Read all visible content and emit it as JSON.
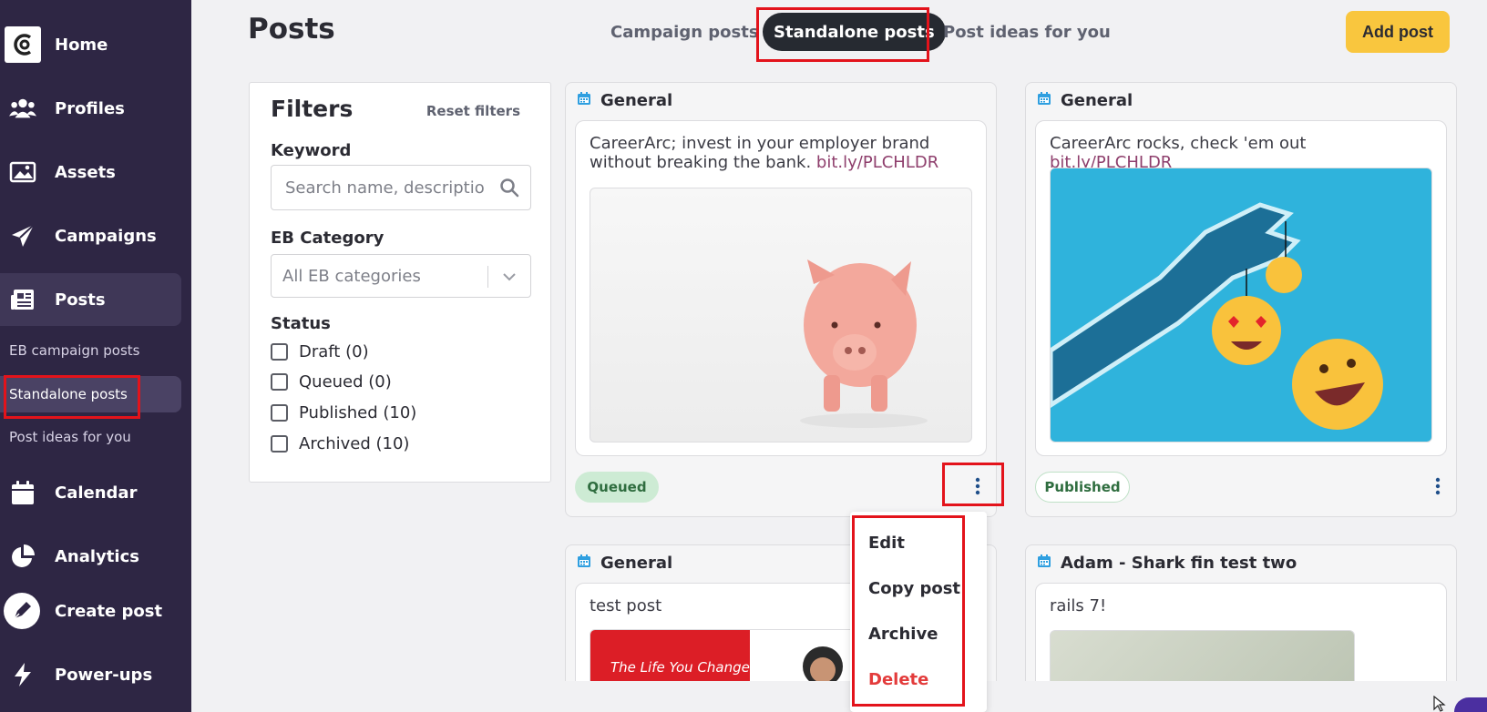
{
  "sidebar": {
    "items": [
      {
        "label": "Home",
        "icon": "home-logo-icon"
      },
      {
        "label": "Profiles",
        "icon": "users-icon"
      },
      {
        "label": "Assets",
        "icon": "image-icon"
      },
      {
        "label": "Campaigns",
        "icon": "paper-plane-icon"
      },
      {
        "label": "Posts",
        "icon": "newspaper-icon"
      },
      {
        "label": "Calendar",
        "icon": "calendar-icon"
      },
      {
        "label": "Analytics",
        "icon": "pie-chart-icon"
      },
      {
        "label": "Create post",
        "icon": "pen-icon"
      },
      {
        "label": "Power-ups",
        "icon": "bolt-icon"
      }
    ],
    "sub_items": [
      {
        "label": "EB campaign posts"
      },
      {
        "label": "Standalone posts"
      },
      {
        "label": "Post ideas for you"
      }
    ]
  },
  "header": {
    "title": "Posts",
    "tabs": [
      "Campaign posts",
      "Standalone posts",
      "Post ideas for you"
    ],
    "active_tab": "Standalone posts",
    "add_post_label": "Add post"
  },
  "filters": {
    "title": "Filters",
    "reset_label": "Reset filters",
    "keyword_label": "Keyword",
    "keyword_placeholder": "Search name, description",
    "category_label": "EB Category",
    "category_value": "All EB categories",
    "status_label": "Status",
    "statuses": [
      "Draft (0)",
      "Queued (0)",
      "Published (10)",
      "Archived (10)"
    ]
  },
  "cards": [
    {
      "category": "General",
      "text": "CareerArc; invest in your employer brand without breaking the bank.",
      "link": "bit.ly/PLCHLDR",
      "status": "Queued"
    },
    {
      "category": "General",
      "text": "CareerArc rocks, check 'em out",
      "link": "bit.ly/PLCHLDR",
      "status": "Published"
    },
    {
      "category": "General",
      "text": "test post",
      "image_caption": "The Life You Change"
    },
    {
      "category": "Adam - Shark fin test two",
      "text": "rails 7!"
    }
  ],
  "menu": {
    "items": [
      "Edit",
      "Copy post",
      "Archive",
      "Delete"
    ]
  },
  "colors": {
    "sidebar_bg": "#2e2644",
    "accent_yellow": "#f9c63e",
    "highlight_red": "#e3131b",
    "link": "#8e3e6c",
    "danger": "#e33b3b"
  }
}
